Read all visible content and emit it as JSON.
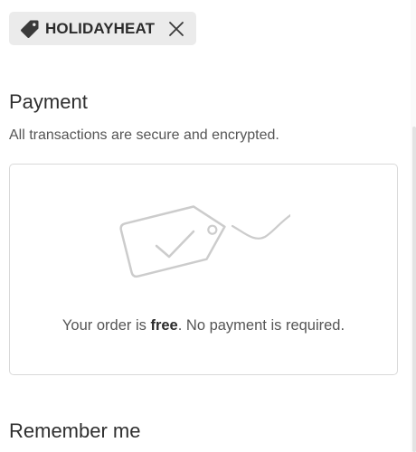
{
  "discount": {
    "code": "HOLIDAYHEAT",
    "tag_icon": "tag-icon",
    "remove_icon": "close-icon"
  },
  "payment": {
    "title": "Payment",
    "subtitle": "All transactions are secure and encrypted.",
    "free_message_prefix": "Your order is ",
    "free_message_bold": "free",
    "free_message_suffix": ". No payment is required.",
    "illustration_icon": "price-tag-check-icon"
  },
  "remember_me": {
    "title": "Remember me"
  },
  "colors": {
    "chip_background": "#ebebeb",
    "box_border": "#d9d9d9",
    "illustration_stroke": "#cccccc"
  }
}
